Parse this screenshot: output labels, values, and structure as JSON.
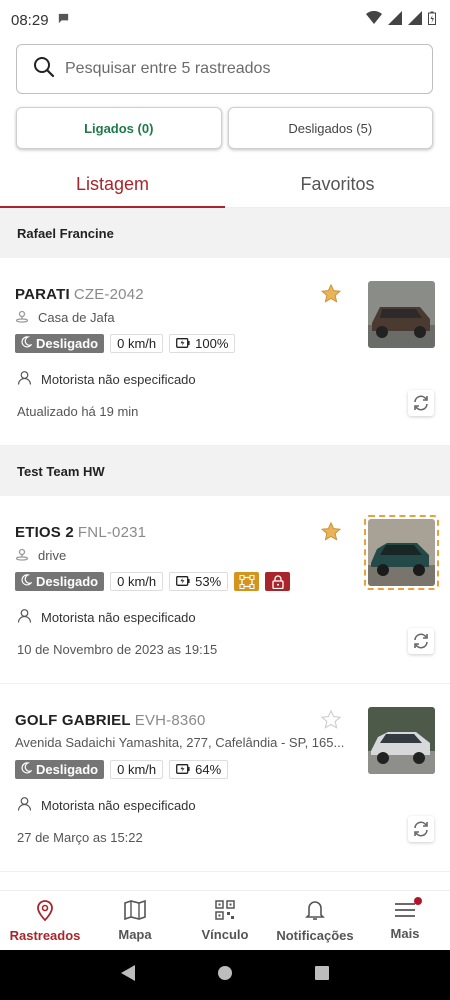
{
  "status_bar": {
    "time": "08:29"
  },
  "search": {
    "placeholder": "Pesquisar entre 5 rastreados"
  },
  "toggles": {
    "on_label": "Ligados (0)",
    "off_label": "Desligados (5)"
  },
  "tabs": [
    {
      "label": "Listagem"
    },
    {
      "label": "Favoritos"
    }
  ],
  "groups": [
    {
      "title": "Rafael Francine",
      "vehicles": [
        {
          "name": "PARATI",
          "plate": "CZE-2042",
          "location": "Casa de Jafa",
          "status": "Desligado",
          "speed": "0 km/h",
          "battery": "100%",
          "driver": "Motorista não especificado",
          "updated": "Atualizado há 19 min",
          "favorite": true
        }
      ]
    },
    {
      "title": "Test Team HW",
      "vehicles": [
        {
          "name": "ETIOS 2",
          "plate": "FNL-0231",
          "location": "drive",
          "status": "Desligado",
          "speed": "0 km/h",
          "battery": "53%",
          "driver": "Motorista não especificado",
          "updated": "10 de Novembro de 2023 as 19:15",
          "favorite": true
        },
        {
          "name": "GOLF GABRIEL",
          "plate": "EVH-8360",
          "location": "Avenida Sadaichi Yamashita, 277, Cafelândia - SP, 165...",
          "status": "Desligado",
          "speed": "0 km/h",
          "battery": "64%",
          "driver": "Motorista não especificado",
          "updated": "27 de Março as 15:22",
          "favorite": false
        }
      ]
    }
  ],
  "bottom_nav": [
    {
      "label": "Rastreados",
      "icon": "map-pin-icon"
    },
    {
      "label": "Mapa",
      "icon": "map-icon"
    },
    {
      "label": "Vínculo",
      "icon": "qr-code-icon"
    },
    {
      "label": "Notificações",
      "icon": "bell-icon"
    },
    {
      "label": "Mais",
      "icon": "menu-icon"
    }
  ],
  "colors": {
    "accent": "#a8262b",
    "on_green": "#1e7a4a",
    "star": "#e9b35a",
    "status_grey": "#757575"
  }
}
